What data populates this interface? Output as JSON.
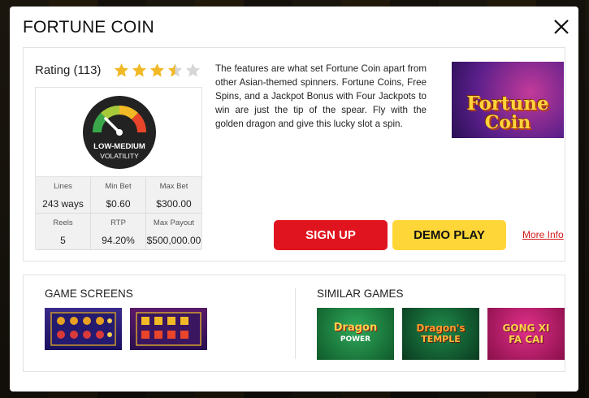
{
  "modal": {
    "title": "FORTUNE COIN",
    "close_icon": "close-icon"
  },
  "rating": {
    "label": "Rating (113)",
    "value": 3.5,
    "max": 5,
    "star_color": "#f2b926",
    "empty_star_color": "#d6d6d6"
  },
  "volatility": {
    "line1": "LOW-MEDIUM",
    "line2": "VOLATILITY"
  },
  "stats": [
    {
      "label": "Lines",
      "value": "243 ways"
    },
    {
      "label": "Min Bet",
      "value": "$0.60"
    },
    {
      "label": "Max Bet",
      "value": "$300.00"
    },
    {
      "label": "Reels",
      "value": "5"
    },
    {
      "label": "RTP",
      "value": "94.20%"
    },
    {
      "label": "Max Payout",
      "value": "$500,000.00"
    }
  ],
  "description": "The features are what set Fortune Coin apart from other Asian-themed spinners. Fortune Coins, Free Spins, and a Jackpot Bonus with Four Jackpots to win are just the tip of the spear. Fly with the golden dragon and give this lucky slot a spin.",
  "game_thumb": {
    "line1": "Fortune",
    "line2": "Coin"
  },
  "actions": {
    "signup_label": "SIGN UP",
    "demo_label": "DEMO PLAY",
    "more_info_label": "More Info"
  },
  "game_screens": {
    "title": "GAME SCREENS"
  },
  "similar_games": {
    "title": "SIMILAR GAMES",
    "items": [
      {
        "line1": "Dragon",
        "line2": "POWER"
      },
      {
        "line1": "Dragon's",
        "line2": "TEMPLE"
      },
      {
        "line1": "GONG XI",
        "line2": "FA CAI"
      }
    ]
  },
  "colors": {
    "accent_red": "#e0141e",
    "accent_yellow": "#ffd638",
    "link_red": "#d11a1a"
  }
}
